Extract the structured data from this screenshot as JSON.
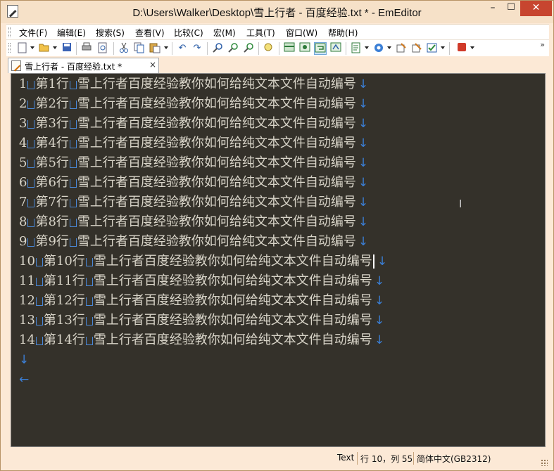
{
  "window": {
    "title": "D:\\Users\\Walker\\Desktop\\雪上行者 - 百度经验.txt * - EmEditor",
    "min_glyph": "–",
    "max_glyph": "☐",
    "close_glyph": "✕"
  },
  "menu": {
    "items": [
      {
        "label": "文件(F)"
      },
      {
        "label": "编辑(E)"
      },
      {
        "label": "搜索(S)"
      },
      {
        "label": "查看(V)"
      },
      {
        "label": "比较(C)"
      },
      {
        "label": "宏(M)"
      },
      {
        "label": "工具(T)"
      },
      {
        "label": "窗口(W)"
      },
      {
        "label": "帮助(H)"
      }
    ]
  },
  "toolbar": {
    "overflow": "»",
    "icons": [
      "new-icon",
      "open-icon",
      "save-icon",
      "print-icon",
      "print-preview-icon",
      "cut-icon",
      "copy-icon",
      "paste-icon",
      "undo-icon",
      "redo-icon",
      "find-icon",
      "find-next-icon",
      "find-prev-icon",
      "highlight-icon",
      "workspace-icon",
      "word-wrap-icon",
      "word-wrap-window-icon",
      "marks-icon",
      "config-icon",
      "bookmark-icon",
      "properties-icon",
      "outline-icon",
      "record-macro-icon"
    ]
  },
  "tab": {
    "label": "雪上行者 - 百度经验.txt *",
    "close_glyph": "×"
  },
  "editor": {
    "lines": [
      {
        "num": "1",
        "label": "第1行",
        "text": "雪上行者百度经验教你如何给纯文本文件自动编号"
      },
      {
        "num": "2",
        "label": "第2行",
        "text": "雪上行者百度经验教你如何给纯文本文件自动编号"
      },
      {
        "num": "3",
        "label": "第3行",
        "text": "雪上行者百度经验教你如何给纯文本文件自动编号"
      },
      {
        "num": "4",
        "label": "第4行",
        "text": "雪上行者百度经验教你如何给纯文本文件自动编号"
      },
      {
        "num": "5",
        "label": "第5行",
        "text": "雪上行者百度经验教你如何给纯文本文件自动编号"
      },
      {
        "num": "6",
        "label": "第6行",
        "text": "雪上行者百度经验教你如何给纯文本文件自动编号"
      },
      {
        "num": "7",
        "label": "第7行",
        "text": "雪上行者百度经验教你如何给纯文本文件自动编号"
      },
      {
        "num": "8",
        "label": "第8行",
        "text": "雪上行者百度经验教你如何给纯文本文件自动编号"
      },
      {
        "num": "9",
        "label": "第9行",
        "text": "雪上行者百度经验教你如何给纯文本文件自动编号"
      },
      {
        "num": "10",
        "label": "第10行",
        "text": "雪上行者百度经验教你如何给纯文本文件自动编号"
      },
      {
        "num": "11",
        "label": "第11行",
        "text": "雪上行者百度经验教你如何给纯文本文件自动编号"
      },
      {
        "num": "12",
        "label": "第12行",
        "text": "雪上行者百度经验教你如何给纯文本文件自动编号"
      },
      {
        "num": "13",
        "label": "第13行",
        "text": "雪上行者百度经验教你如何给纯文本文件自动编号"
      },
      {
        "num": "14",
        "label": "第14行",
        "text": "雪上行者百度经验教你如何给纯文本文件自动编号"
      }
    ],
    "eol_glyph": "↓",
    "eof_glyph": "←",
    "caret_line": 10
  },
  "status": {
    "mode": "Text",
    "position": "行 10，列 55",
    "encoding": "简体中文(GB2312)"
  },
  "colors": {
    "editor_bg": "#34312a",
    "editor_text": "#d8d4c8",
    "marker_blue": "#3b7fd6",
    "frame": "#fce9d6",
    "close_red": "#c7452f"
  }
}
